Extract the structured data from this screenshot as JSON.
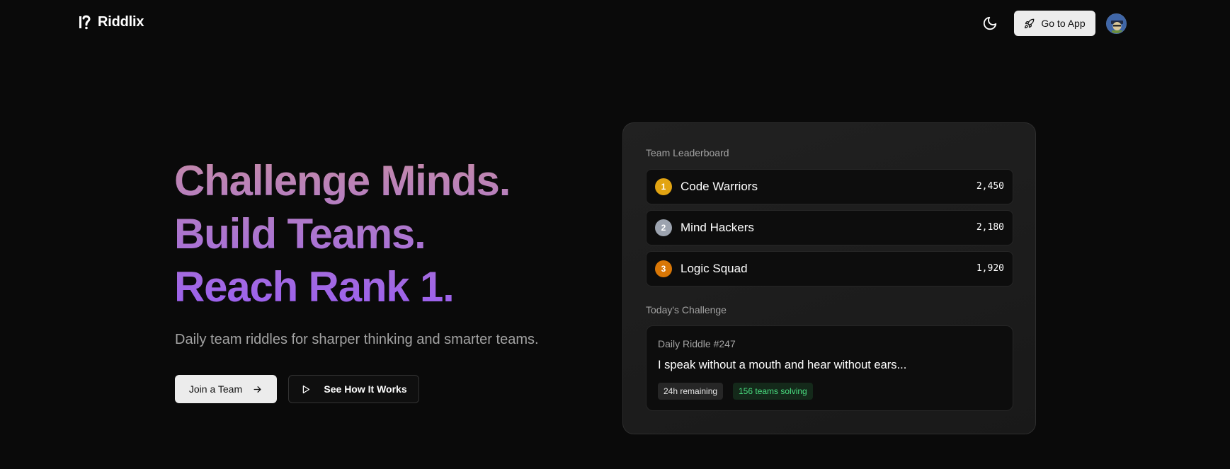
{
  "header": {
    "brand_name": "Riddlix",
    "go_to_app_label": "Go to App"
  },
  "hero": {
    "title_lines": [
      "Challenge Minds.",
      "Build Teams.",
      "Reach Rank 1."
    ],
    "subtitle": "Daily team riddles for sharper thinking and smarter teams.",
    "primary_button_label": "Join a Team",
    "secondary_button_label": "See How It Works"
  },
  "leaderboard": {
    "heading": "Team Leaderboard",
    "rows": [
      {
        "rank": "1",
        "team": "Code Warriors",
        "score": "2,450",
        "badge_color": "#e2a412"
      },
      {
        "rank": "2",
        "team": "Mind Hackers",
        "score": "2,180",
        "badge_color": "#9ca3af"
      },
      {
        "rank": "3",
        "team": "Logic Squad",
        "score": "1,920",
        "badge_color": "#d97706"
      }
    ]
  },
  "challenge": {
    "heading": "Today's Challenge",
    "riddle_number": "Daily Riddle #247",
    "riddle_text": "I speak without a mouth and hear without ears...",
    "time_remaining": "24h remaining",
    "teams_solving": "156 teams solving"
  },
  "colors": {
    "background": "#0a0a0a",
    "gradient_start": "#c58aa8",
    "gradient_end": "#9a5ff0",
    "success": "#4ade80"
  },
  "icons": {
    "brand": "riddle-logo-icon",
    "theme": "moon-icon",
    "go_to_app": "rocket-icon",
    "join": "arrow-right-icon",
    "how": "play-icon"
  }
}
